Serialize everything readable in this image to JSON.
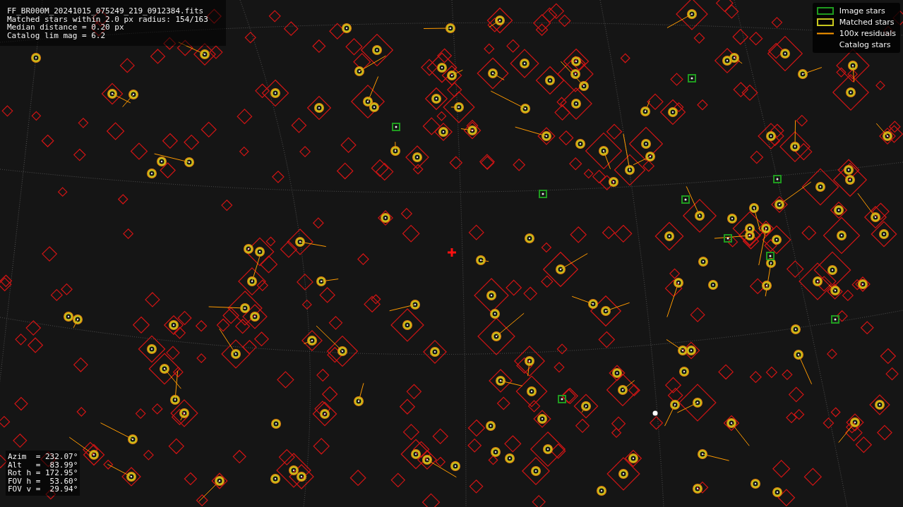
{
  "header": {
    "lines": [
      "FF_BR000M_20241015_075249_219_0912384.fits",
      "Matched stars within 2.0 px radius: 154/163",
      "Median distance = 0.20 px",
      "Catalog lim mag = 6.2"
    ]
  },
  "legend": [
    {
      "label": "Image stars",
      "kind": "box",
      "color": "#1f9a1f"
    },
    {
      "label": "Matched stars",
      "kind": "box",
      "color": "#c8c81e"
    },
    {
      "label": "100x residuals",
      "kind": "line",
      "color": "#ff9a00"
    },
    {
      "label": "Catalog stars",
      "kind": "blank"
    }
  ],
  "pointing": {
    "lines": [
      "Azim  = 232.07°",
      "Alt   =  83.99°",
      "Rot h = 172.95°",
      "FOV h =  53.60°",
      "FOV v =  29.94°"
    ]
  }
}
